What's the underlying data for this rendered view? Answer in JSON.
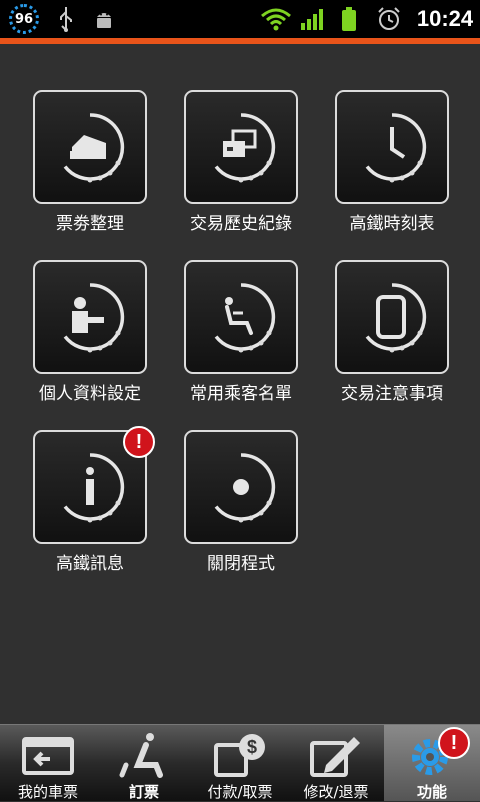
{
  "status_bar": {
    "battery_level": "96",
    "time": "10:24"
  },
  "menu": {
    "items": [
      {
        "label": "票劵整理",
        "icon": "ticket-icon"
      },
      {
        "label": "交易歷史紀錄",
        "icon": "history-icon"
      },
      {
        "label": "高鐵時刻表",
        "icon": "clock-icon"
      },
      {
        "label": "個人資料設定",
        "icon": "person-icon"
      },
      {
        "label": "常用乘客名單",
        "icon": "seat-icon"
      },
      {
        "label": "交易注意事項",
        "icon": "phone-icon"
      },
      {
        "label": "高鐵訊息",
        "icon": "info-icon",
        "badge": "!"
      },
      {
        "label": "關閉程式",
        "icon": "close-app-icon"
      }
    ]
  },
  "tabs": [
    {
      "label": "我的車票",
      "icon": "my-ticket-icon"
    },
    {
      "label": "訂票",
      "icon": "booking-seat-icon"
    },
    {
      "label": "付款/取票",
      "icon": "payment-icon"
    },
    {
      "label": "修改/退票",
      "icon": "edit-icon"
    },
    {
      "label": "功能",
      "icon": "gear-icon",
      "active": true,
      "badge": "!"
    }
  ],
  "colors": {
    "accent": "#e8541a",
    "badge": "#d0141c",
    "battery_ring": "#2a9be8",
    "wifi": "#7ed321"
  }
}
